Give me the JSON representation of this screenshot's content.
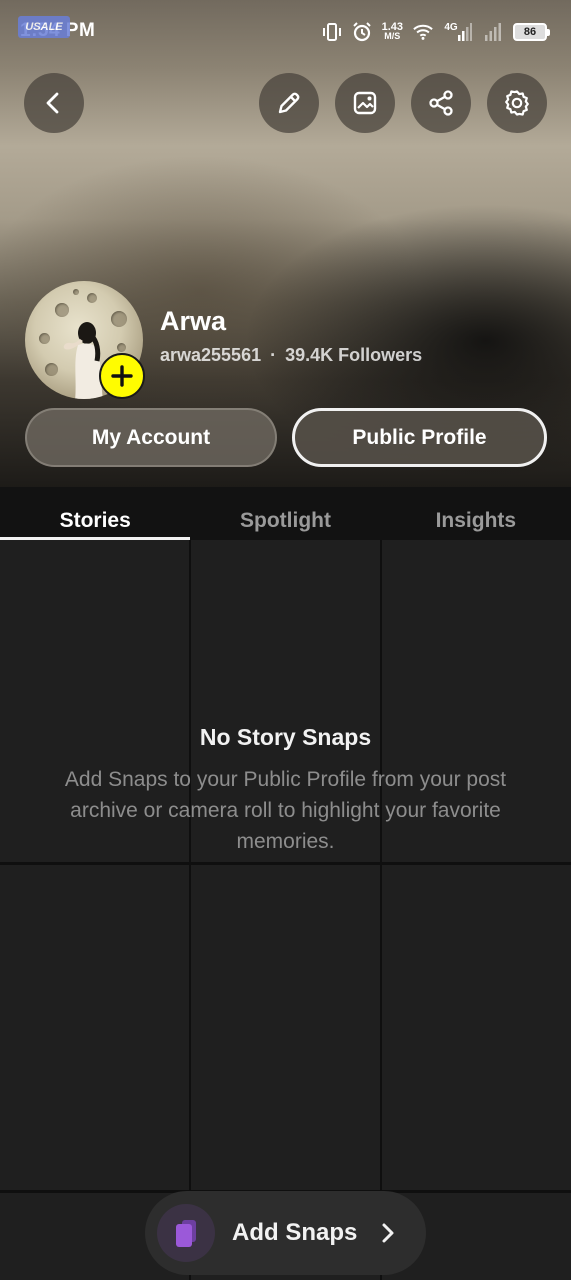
{
  "status_bar": {
    "time": "1:54 PM",
    "overlay_logo": "USALE",
    "speed_value": "1.43",
    "speed_unit": "M/S",
    "network": "4G",
    "battery": "86"
  },
  "profile": {
    "name": "Arwa",
    "username": "arwa255561",
    "separator": "·",
    "followers": "39.4K Followers"
  },
  "buttons": {
    "my_account": "My Account",
    "public_profile": "Public Profile"
  },
  "tabs": [
    {
      "label": "Stories",
      "active": true
    },
    {
      "label": "Spotlight",
      "active": false
    },
    {
      "label": "Insights",
      "active": false
    }
  ],
  "empty_state": {
    "title": "No Story Snaps",
    "body": "Add Snaps to your Public Profile from your post archive or camera roll to highlight your favorite memories."
  },
  "add_snaps": {
    "label": "Add Snaps"
  },
  "icons": {
    "back": "chevron-left-icon",
    "edit": "pencil-icon",
    "gallery": "image-icon",
    "share": "share-icon",
    "settings": "gear-icon",
    "add_story": "plus-icon",
    "snaps": "cards-icon",
    "arrow": "chevron-right-icon"
  },
  "colors": {
    "snap_yellow": "#fffc00",
    "snaps_purple": "#9b59d9",
    "background": "#121212"
  }
}
